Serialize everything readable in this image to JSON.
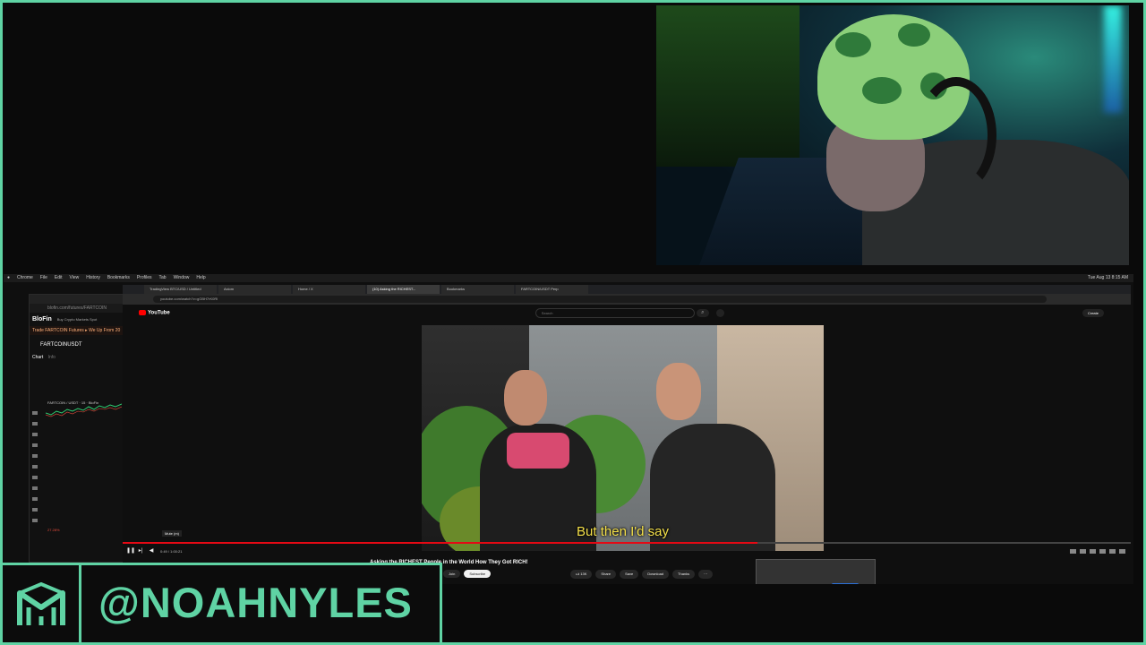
{
  "menubar": {
    "items": [
      "Chrome",
      "File",
      "Edit",
      "View",
      "History",
      "Bookmarks",
      "Profiles",
      "Tab",
      "Window",
      "Help"
    ],
    "clock": "Tue Aug 13  8:15 AM"
  },
  "blofin": {
    "brand": "BloFin",
    "nav": "Buy Crypto   Markets   Spot",
    "notice": "Trade FARTCOIN Futures ▸ We Up From 20",
    "pair": "FARTCOINUSDT",
    "tab_chart": "Chart",
    "tab_info": "Info",
    "chart_label": "FARTCOIN / USDT · 15 · BloFin",
    "price_label": "27.28%"
  },
  "browser": {
    "tabs": [
      {
        "label": "TradingView BTC/USD / Untitled",
        "active": false
      },
      {
        "label": "Axiom",
        "active": false
      },
      {
        "label": "Home / X",
        "active": false
      },
      {
        "label": "(10) Asking the RICHEST...",
        "active": true
      },
      {
        "label": "Bookmarks",
        "active": false
      },
      {
        "label": "FARTCOIN/USDT Perp",
        "active": false
      }
    ],
    "url": "youtube.com/watch?v=gGBH7rK0RI",
    "left_url": "blofin.com/futures/FARTCOIN"
  },
  "youtube": {
    "logo": "YouTube",
    "search_placeholder": "Search",
    "create_label": "Create",
    "caption": "But then I'd say",
    "tooltip": "Mute (m)",
    "time": "0:49 / 1:00:21",
    "progress": 0.63,
    "video_title": "Asking the RICHEST People in the World How They Got RICH!",
    "join_label": "Join",
    "subscribe_label": "Subscribe",
    "like_count": "13K",
    "share_label": "Share",
    "save_label": "Save",
    "download_label": "Download",
    "thanks_label": "Thanks"
  },
  "banner": {
    "handle": "@NOAHNYLES"
  },
  "colors": {
    "accent": "#5fd3a4",
    "caption": "#f4e04a",
    "progress": "#e50914"
  }
}
